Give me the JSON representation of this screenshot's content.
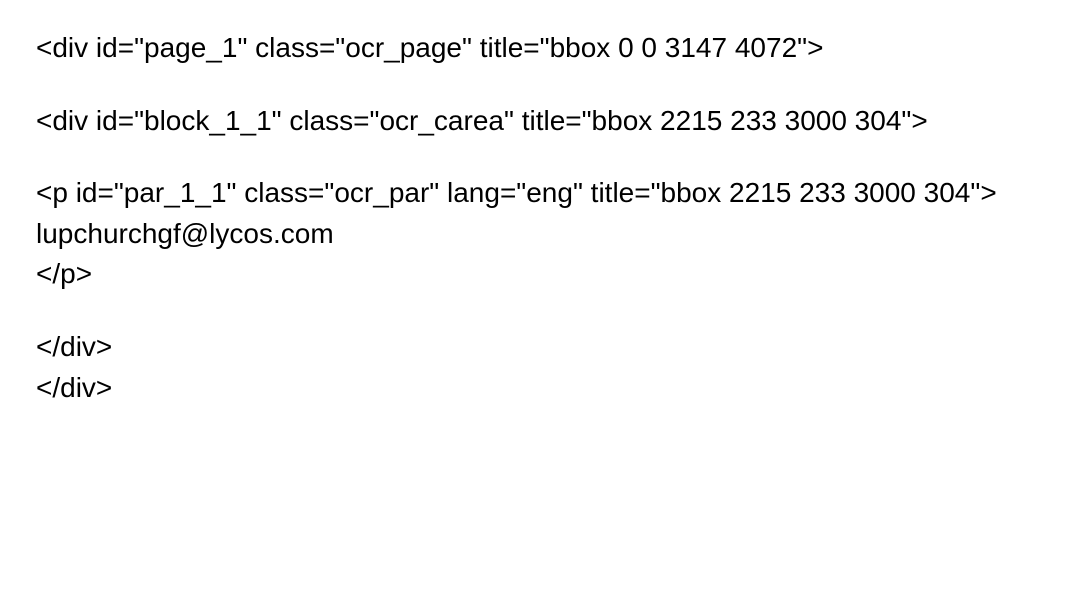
{
  "lines": {
    "l1": "<div id=\"page_1\" class=\"ocr_page\" title=\"bbox 0 0 3147 4072\">",
    "l2": "<div id=\"block_1_1\" class=\"ocr_carea\" title=\"bbox 2215 233 3000 304\">",
    "l3": "<p id=\"par_1_1\" class=\"ocr_par\" lang=\"eng\" title=\"bbox 2215 233 3000 304\">",
    "l4": "lupchurchgf@lycos.com",
    "l5": "</p>",
    "l6": "</div>",
    "l7": "</div>"
  }
}
